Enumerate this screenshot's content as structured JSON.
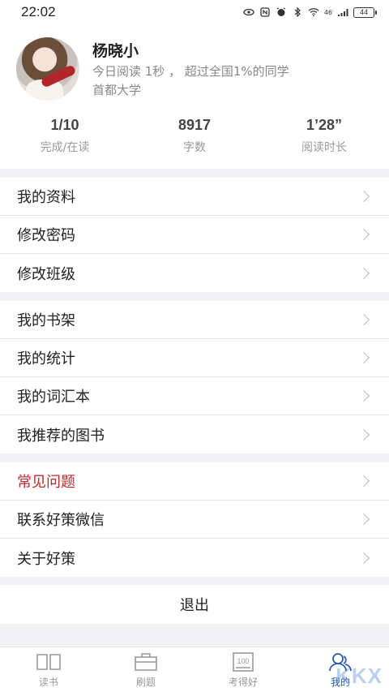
{
  "status_bar": {
    "time": "22:02",
    "network": "46",
    "battery": "44"
  },
  "profile": {
    "name": "杨晓小",
    "reading_today": "今日阅读 1秒 ， 超过全国1%的同学",
    "school": "首都大学"
  },
  "stats": [
    {
      "value": "1/10",
      "label": "完成/在读"
    },
    {
      "value": "8917",
      "label": "字数"
    },
    {
      "value": "1’28”",
      "label": "阅读时长"
    }
  ],
  "menu_groups": [
    [
      {
        "label": "我的资料"
      },
      {
        "label": "修改密码"
      },
      {
        "label": "修改班级"
      }
    ],
    [
      {
        "label": "我的书架"
      },
      {
        "label": "我的统计"
      },
      {
        "label": "我的词汇本"
      },
      {
        "label": "我推荐的图书"
      }
    ],
    [
      {
        "label": "常见问题"
      },
      {
        "label": "联系好策微信"
      },
      {
        "label": "关于好策"
      }
    ]
  ],
  "logout_label": "退出",
  "tabs": [
    {
      "label": "读书",
      "icon": "book-icon"
    },
    {
      "label": "刷题",
      "icon": "toolbox-icon"
    },
    {
      "label": "考得好",
      "icon": "score-100-icon"
    },
    {
      "label": "我的",
      "icon": "user-icon"
    }
  ],
  "watermark": "KKX",
  "colors": {
    "accent": "#2b5fa8",
    "highlight": "#c0282b",
    "background": "#f2f2f4"
  }
}
